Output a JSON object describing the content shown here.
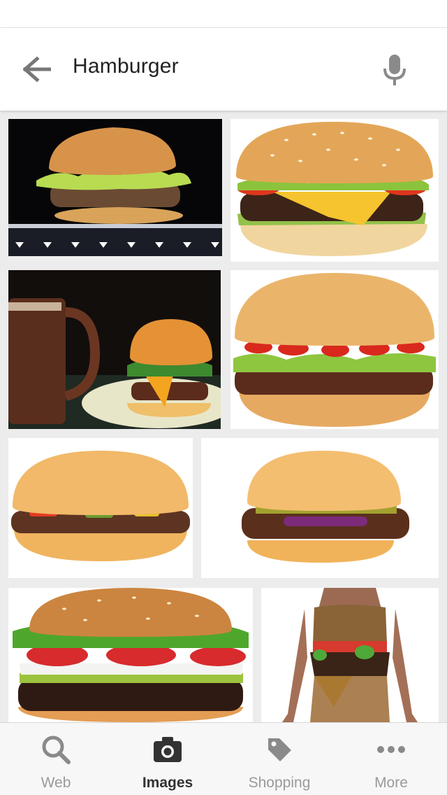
{
  "search": {
    "query": "Hamburger"
  },
  "images": [
    {
      "name": "image-burger-lettuce-dark"
    },
    {
      "name": "image-cheeseburger-tomato"
    },
    {
      "name": "image-burger-mug"
    },
    {
      "name": "image-burger-ketchup-lettuce"
    },
    {
      "name": "image-plain-hamburger"
    },
    {
      "name": "image-burger-onion-pickle"
    },
    {
      "name": "image-burger-close-up"
    },
    {
      "name": "image-burger-dress"
    }
  ],
  "nav": {
    "items": [
      {
        "label": "Web",
        "icon": "search-icon"
      },
      {
        "label": "Images",
        "icon": "camera-icon"
      },
      {
        "label": "Shopping",
        "icon": "tag-icon"
      },
      {
        "label": "More",
        "icon": "more-icon"
      }
    ],
    "active": "Images"
  },
  "colors": {
    "active": "#333333",
    "inactive": "#9a9a9a",
    "icon_gray": "#8a8a8a"
  }
}
